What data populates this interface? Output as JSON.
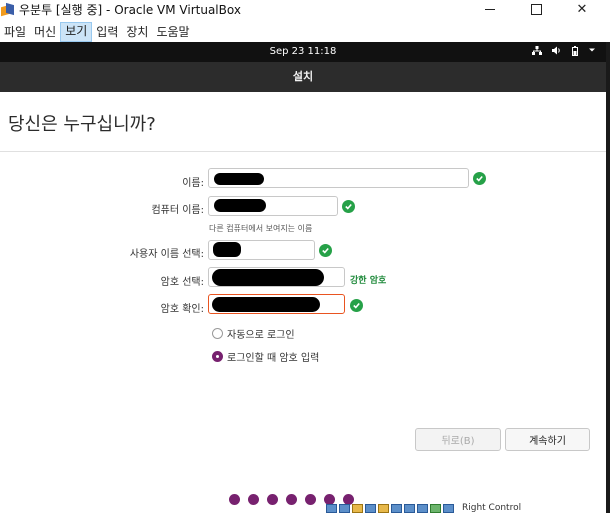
{
  "window": {
    "title": "우분투 [실행 중] - Oracle VM VirtualBox",
    "minimize": "─",
    "maximize": "☐",
    "close": "✕"
  },
  "menu": [
    "파일",
    "머신",
    "보기",
    "입력",
    "장치",
    "도움말"
  ],
  "menu_active_index": 2,
  "guest_bar": {
    "clock": "Sep 23  11:18",
    "sys_icons": [
      "network-icon",
      "volume-icon",
      "battery-icon",
      "chevron-down-icon"
    ]
  },
  "installer": {
    "header": "설치",
    "page_title": "당신은 누구십니까?",
    "fields": {
      "name": {
        "label": "이름:"
      },
      "computer_name": {
        "label": "컴퓨터 이름:",
        "hint": "다른 컴퓨터에서 보여지는 이름"
      },
      "username": {
        "label": "사용자 이름 선택:"
      },
      "password": {
        "label": "암호 선택:",
        "strength": "강한 암호"
      },
      "confirm": {
        "label": "암호 확인:"
      }
    },
    "login_options": {
      "auto": "자동으로 로그인",
      "require_password": "로그인할 때 암호 입력",
      "selected": "require_password"
    },
    "buttons": {
      "back": "뒤로(B)",
      "continue": "계속하기"
    },
    "progress": {
      "total": 7,
      "filled": 7
    }
  },
  "statusbar": {
    "hostkey": "Right Control"
  },
  "colors": {
    "accent": "#77216f",
    "ok": "#26a148",
    "focus": "#e95420"
  }
}
